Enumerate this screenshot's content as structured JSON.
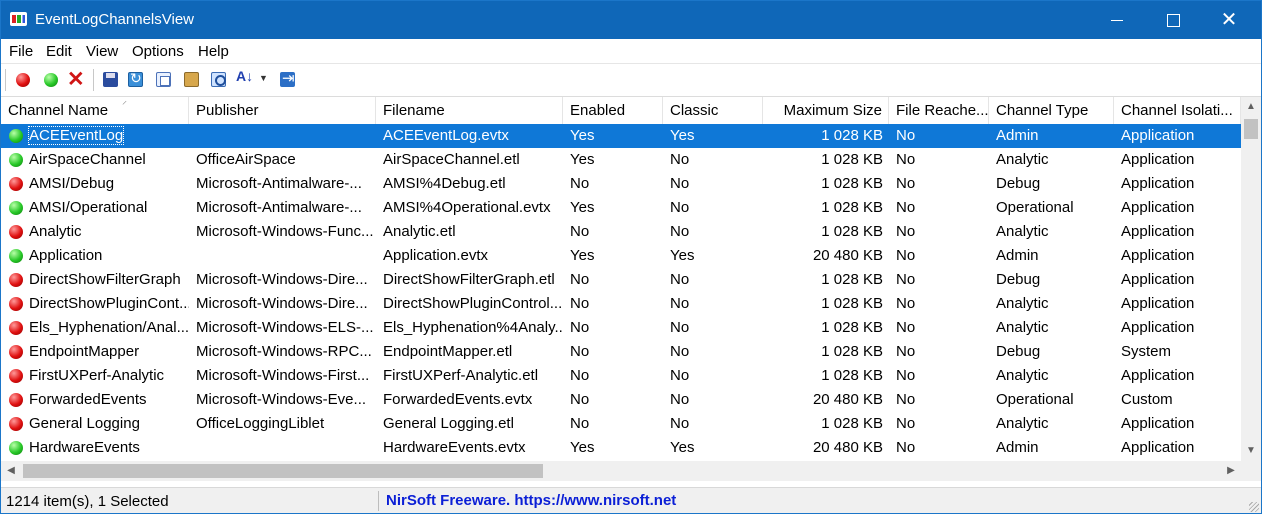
{
  "window": {
    "title": "EventLogChannelsView"
  },
  "menu": [
    "File",
    "Edit",
    "View",
    "Options",
    "Help"
  ],
  "toolbar": {
    "buttons": [
      {
        "icon": "red-ball-icon",
        "action": "disable"
      },
      {
        "icon": "green-ball-icon",
        "action": "enable"
      },
      {
        "icon": "delete-x-icon",
        "action": "delete"
      },
      {
        "icon": "save-icon",
        "action": "save"
      },
      {
        "icon": "refresh-icon",
        "action": "refresh"
      },
      {
        "icon": "copy-icon",
        "action": "copy"
      },
      {
        "icon": "properties-icon",
        "action": "properties"
      },
      {
        "icon": "find-icon",
        "action": "find"
      },
      {
        "icon": "sort-icon",
        "action": "sort"
      },
      {
        "icon": "exit-icon",
        "action": "exit"
      }
    ]
  },
  "columns": [
    "Channel Name",
    "Publisher",
    "Filename",
    "Enabled",
    "Classic",
    "Maximum Size",
    "File Reache...",
    "Channel Type",
    "Channel Isolati..."
  ],
  "rows": [
    {
      "status": "green",
      "name": "ACEEventLog",
      "publisher": "",
      "filename": "ACEEventLog.evtx",
      "enabled": "Yes",
      "classic": "Yes",
      "max_size": "1 028 KB",
      "file_reached": "No",
      "type": "Admin",
      "isolation": "Application",
      "selected": true
    },
    {
      "status": "green",
      "name": "AirSpaceChannel",
      "publisher": "OfficeAirSpace",
      "filename": "AirSpaceChannel.etl",
      "enabled": "Yes",
      "classic": "No",
      "max_size": "1 028 KB",
      "file_reached": "No",
      "type": "Analytic",
      "isolation": "Application"
    },
    {
      "status": "red",
      "name": "AMSI/Debug",
      "publisher": "Microsoft-Antimalware-...",
      "filename": "AMSI%4Debug.etl",
      "enabled": "No",
      "classic": "No",
      "max_size": "1 028 KB",
      "file_reached": "No",
      "type": "Debug",
      "isolation": "Application"
    },
    {
      "status": "green",
      "name": "AMSI/Operational",
      "publisher": "Microsoft-Antimalware-...",
      "filename": "AMSI%4Operational.evtx",
      "enabled": "Yes",
      "classic": "No",
      "max_size": "1 028 KB",
      "file_reached": "No",
      "type": "Operational",
      "isolation": "Application"
    },
    {
      "status": "red",
      "name": "Analytic",
      "publisher": "Microsoft-Windows-Func...",
      "filename": "Analytic.etl",
      "enabled": "No",
      "classic": "No",
      "max_size": "1 028 KB",
      "file_reached": "No",
      "type": "Analytic",
      "isolation": "Application"
    },
    {
      "status": "green",
      "name": "Application",
      "publisher": "",
      "filename": "Application.evtx",
      "enabled": "Yes",
      "classic": "Yes",
      "max_size": "20 480 KB",
      "file_reached": "No",
      "type": "Admin",
      "isolation": "Application"
    },
    {
      "status": "red",
      "name": "DirectShowFilterGraph",
      "publisher": "Microsoft-Windows-Dire...",
      "filename": "DirectShowFilterGraph.etl",
      "enabled": "No",
      "classic": "No",
      "max_size": "1 028 KB",
      "file_reached": "No",
      "type": "Debug",
      "isolation": "Application"
    },
    {
      "status": "red",
      "name": "DirectShowPluginCont...",
      "publisher": "Microsoft-Windows-Dire...",
      "filename": "DirectShowPluginControl...",
      "enabled": "No",
      "classic": "No",
      "max_size": "1 028 KB",
      "file_reached": "No",
      "type": "Analytic",
      "isolation": "Application"
    },
    {
      "status": "red",
      "name": "Els_Hyphenation/Anal...",
      "publisher": "Microsoft-Windows-ELS-...",
      "filename": "Els_Hyphenation%4Analy...",
      "enabled": "No",
      "classic": "No",
      "max_size": "1 028 KB",
      "file_reached": "No",
      "type": "Analytic",
      "isolation": "Application"
    },
    {
      "status": "red",
      "name": "EndpointMapper",
      "publisher": "Microsoft-Windows-RPC...",
      "filename": "EndpointMapper.etl",
      "enabled": "No",
      "classic": "No",
      "max_size": "1 028 KB",
      "file_reached": "No",
      "type": "Debug",
      "isolation": "System"
    },
    {
      "status": "red",
      "name": "FirstUXPerf-Analytic",
      "publisher": "Microsoft-Windows-First...",
      "filename": "FirstUXPerf-Analytic.etl",
      "enabled": "No",
      "classic": "No",
      "max_size": "1 028 KB",
      "file_reached": "No",
      "type": "Analytic",
      "isolation": "Application"
    },
    {
      "status": "red",
      "name": "ForwardedEvents",
      "publisher": "Microsoft-Windows-Eve...",
      "filename": "ForwardedEvents.evtx",
      "enabled": "No",
      "classic": "No",
      "max_size": "20 480 KB",
      "file_reached": "No",
      "type": "Operational",
      "isolation": "Custom"
    },
    {
      "status": "red",
      "name": "General Logging",
      "publisher": "OfficeLoggingLiblet",
      "filename": "General Logging.etl",
      "enabled": "No",
      "classic": "No",
      "max_size": "1 028 KB",
      "file_reached": "No",
      "type": "Analytic",
      "isolation": "Application"
    },
    {
      "status": "green",
      "name": "HardwareEvents",
      "publisher": "",
      "filename": "HardwareEvents.evtx",
      "enabled": "Yes",
      "classic": "Yes",
      "max_size": "20 480 KB",
      "file_reached": "No",
      "type": "Admin",
      "isolation": "Application"
    }
  ],
  "status": {
    "count": "1214 item(s), 1 Selected",
    "link": "NirSoft Freeware. https://www.nirsoft.net"
  },
  "colors": {
    "titlebar": "#0f67b8",
    "selection": "#0f78d7",
    "link": "#0b1fd6"
  }
}
